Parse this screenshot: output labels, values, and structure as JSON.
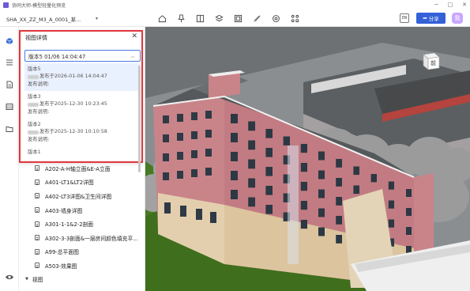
{
  "app": {
    "title": "协同大师-模型轻量化预览",
    "window_controls": [
      "─",
      "□",
      "✕"
    ]
  },
  "toolbar": {
    "model_name": "SHA_XX_ZZ_M3_A_0001_某...",
    "tools": [
      "home-icon",
      "pin-icon",
      "split-view-icon",
      "layers-icon",
      "section-icon",
      "measure-icon",
      "settings-icon",
      "share-node-icon"
    ],
    "lang_label": "EN",
    "share_label": "分享",
    "avatar_initial": "我"
  },
  "popup": {
    "title": "视图详情",
    "close_label": "✕",
    "selected_version": "版本5 01/06 14:04:47",
    "versions": [
      {
        "name": "版本5",
        "date": "发布于2026-01-06 14:04:47",
        "note": "发布说明:"
      },
      {
        "name": "版本3",
        "date": "发布于2025-12-30 10:23:45",
        "note": "发布说明:"
      },
      {
        "name": "版本2",
        "date": "发布于2025-12-30 10:10:58",
        "note": "发布说明:"
      },
      {
        "name": "版本1",
        "date": "",
        "note": ""
      }
    ]
  },
  "tree": {
    "items": [
      "A202-A-H轴立面&E-A立面",
      "A401-LT1&LT2详图",
      "A402-LT3详图&卫生间详图",
      "A403-墙身详图",
      "A301-1-1&2-2剖面",
      "A302-3-3剖面&一层房间颜色填充平...",
      "A99-总平面图",
      "A503-效果图"
    ],
    "group_label": "视图"
  },
  "viewcube_label": "前",
  "colors": {
    "accent": "#3461d8",
    "highlight_border": "#e0383e",
    "facade_pink": "#c9848a",
    "facade_tan": "#e3cfae",
    "ground": "#3f6e1c",
    "tree_gray": "#9b9b9b"
  }
}
